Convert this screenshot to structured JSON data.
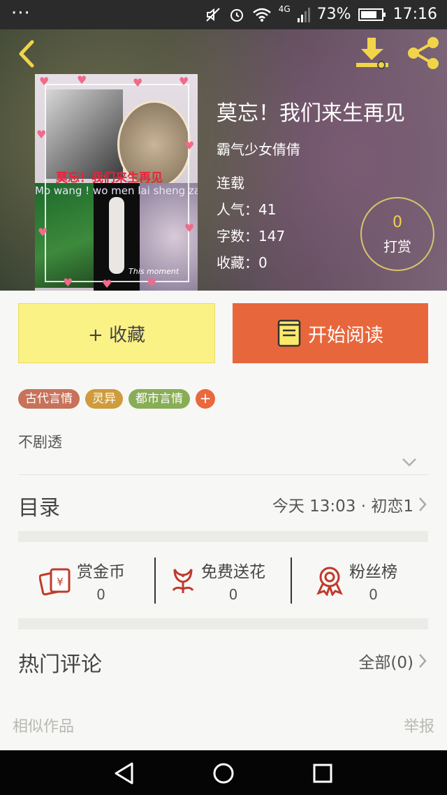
{
  "status_bar": {
    "menu_dots": "···",
    "network": "4G",
    "battery_percent": "73%",
    "time": "17:16"
  },
  "header": {
    "back_icon": "chevron-left-icon",
    "download_icon": "download-icon",
    "share_icon": "share-icon",
    "accent_color": "#f2d44a"
  },
  "book": {
    "title": "莫忘！我们来生再见",
    "author": "霸气少女倩倩",
    "status": "连载",
    "popularity": "人气：41",
    "word_count": "字数：147",
    "favorites": "收藏：0",
    "cover": {
      "title_text": "莫忘！我们来生再见",
      "pinyin_text": "Mo wang ! wo men lai sheng zai jian",
      "caption": "This moment"
    }
  },
  "reward": {
    "count": "0",
    "label": "打赏"
  },
  "actions": {
    "favorite_label": "+ 收藏",
    "read_label": "开始阅读",
    "read_color": "#e8663c",
    "favorite_color": "#fbf286"
  },
  "tags": [
    {
      "label": "古代言情",
      "color": "#c7725a"
    },
    {
      "label": "灵异",
      "color": "#cf9b3d"
    },
    {
      "label": "都市言情",
      "color": "#88ad57"
    }
  ],
  "tag_add_label": "+",
  "synopsis": {
    "text": "不剧透",
    "expand_icon": "chevron-down-icon"
  },
  "toc": {
    "label": "目录",
    "latest": "今天 13:03 · 初恋1"
  },
  "stats": [
    {
      "label": "赏金币",
      "value": "0",
      "icon": "coin-envelope-icon"
    },
    {
      "label": "免费送花",
      "value": "0",
      "icon": "flower-icon"
    },
    {
      "label": "粉丝榜",
      "value": "0",
      "icon": "medal-icon"
    }
  ],
  "comments": {
    "label": "热门评论",
    "all_label": "全部(0)"
  },
  "footer": {
    "similar": "相似作品",
    "report": "举报"
  },
  "navbar": {
    "back_icon": "nav-back-icon",
    "home_icon": "nav-home-icon",
    "recents_icon": "nav-recents-icon"
  }
}
